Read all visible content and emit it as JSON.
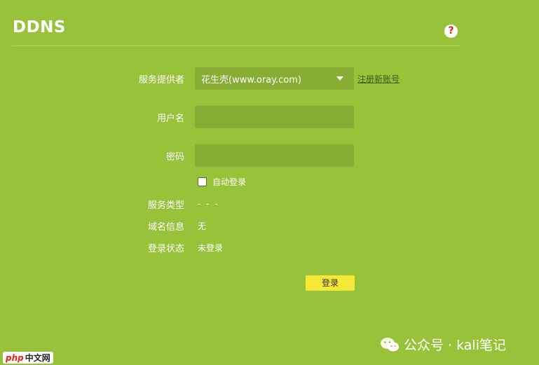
{
  "header": {
    "title": "DDNS",
    "help_icon": "question-icon",
    "help_glyph": "?"
  },
  "form": {
    "provider_label": "服务提供者",
    "provider_value": "花生壳(www.oray.com)",
    "register_link": "注册新账号",
    "username_label": "用户名",
    "username_value": "",
    "password_label": "密码",
    "password_value": "",
    "auto_login_label": "自动登录",
    "auto_login_checked": false,
    "service_type_label": "服务类型",
    "service_type_value": "- - -",
    "domain_info_label": "域名信息",
    "domain_info_value": "无",
    "login_status_label": "登录状态",
    "login_status_value": "未登录",
    "login_button": "登录"
  },
  "watermark": {
    "text": "公众号 · kali笔记",
    "icon": "wechat-icon"
  },
  "corner_logo": {
    "php_text": "php",
    "cn_text": "中文网"
  },
  "colors": {
    "background": "#97c23a",
    "field_background": "#87ad35",
    "button": "#f5e837",
    "link": "#3f5a14"
  }
}
